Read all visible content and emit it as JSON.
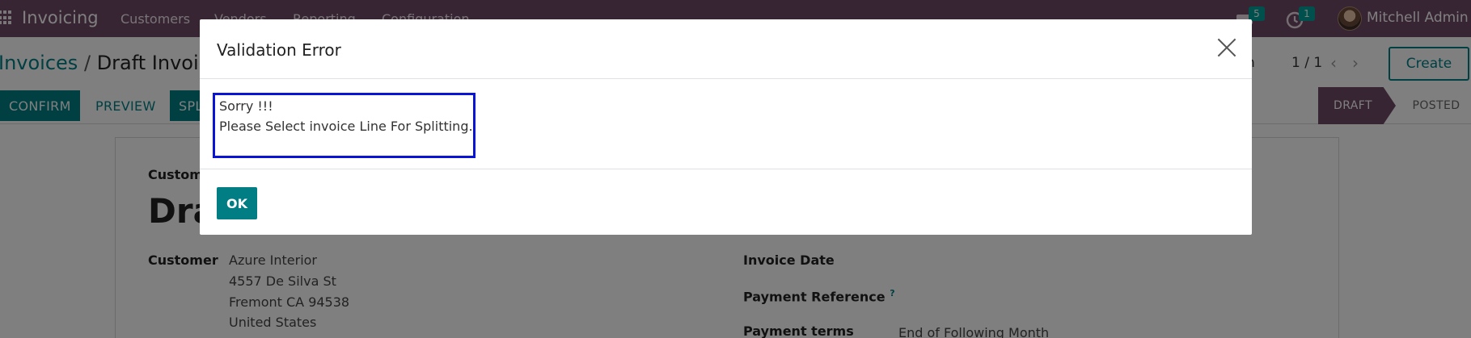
{
  "navbar": {
    "app_title": "Invoicing",
    "menu": [
      "Customers",
      "Vendors",
      "Reporting",
      "Configuration"
    ],
    "chat_count": "5",
    "activity_count": "1",
    "user_name": "Mitchell Admin"
  },
  "breadcrumb": {
    "parent": "Invoices",
    "separator": "/",
    "current": "Draft Invoice"
  },
  "pager": {
    "value": "1 / 1",
    "create_label": "Create",
    "partial_label": "n"
  },
  "actions": {
    "confirm": "CONFIRM",
    "preview": "PREVIEW",
    "split": "SPLIT"
  },
  "status": {
    "draft": "DRAFT",
    "posted": "POSTED"
  },
  "form": {
    "customer_invoice_label": "Customer Invoice",
    "title": "Draft",
    "customer_label": "Customer",
    "customer_lines": [
      "Azure Interior",
      "4557 De Silva St",
      "Fremont CA 94538",
      "United States"
    ],
    "invoice_date_label": "Invoice Date",
    "payment_reference_label": "Payment Reference",
    "payment_reference_help": "?",
    "payment_terms_label": "Payment terms",
    "payment_terms_value": "End of Following Month"
  },
  "modal": {
    "title": "Validation Error",
    "message_line1": "Sorry !!!",
    "message_line2": "Please Select invoice Line For Splitting.",
    "ok_label": "OK",
    "highlight_color": "#0a14d4"
  },
  "colors": {
    "brand": "#714b67",
    "accent": "#017e84",
    "badge": "#00a09d"
  }
}
